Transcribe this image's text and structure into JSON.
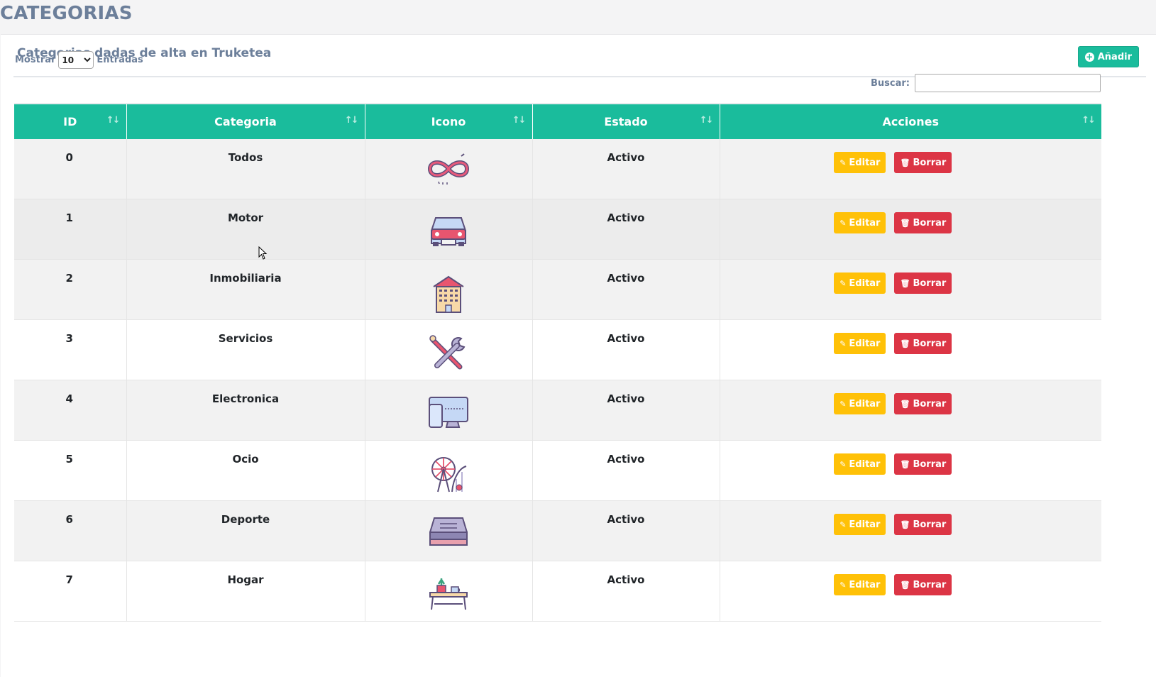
{
  "page": {
    "title": "CATEGORIAS"
  },
  "card": {
    "title": "Categorias dadas de alta en Truketea",
    "add_button": "Añadir"
  },
  "controls": {
    "show_label": "Mostrar",
    "entries_value": "10",
    "entries_label": "Entradas",
    "search_label": "Buscar:",
    "search_value": ""
  },
  "table": {
    "columns": [
      "ID",
      "Categoria",
      "Icono",
      "Estado",
      "Acciones"
    ],
    "edit_label": "Editar",
    "delete_label": "Borrar",
    "rows": [
      {
        "id": "0",
        "categoria": "Todos",
        "icono": "infinity-icon",
        "estado": "Activo"
      },
      {
        "id": "1",
        "categoria": "Motor",
        "icono": "car-icon",
        "estado": "Activo"
      },
      {
        "id": "2",
        "categoria": "Inmobiliaria",
        "icono": "building-icon",
        "estado": "Activo"
      },
      {
        "id": "3",
        "categoria": "Servicios",
        "icono": "tools-icon",
        "estado": "Activo"
      },
      {
        "id": "4",
        "categoria": "Electronica",
        "icono": "devices-icon",
        "estado": "Activo"
      },
      {
        "id": "5",
        "categoria": "Ocio",
        "icono": "ferris-wheel-icon",
        "estado": "Activo"
      },
      {
        "id": "6",
        "categoria": "Deporte",
        "icono": "tray-icon",
        "estado": "Activo"
      },
      {
        "id": "7",
        "categoria": "Hogar",
        "icono": "home-decor-icon",
        "estado": "Activo"
      }
    ]
  },
  "colors": {
    "header_bg": "#1abc9c",
    "edit_button": "#ffc107",
    "delete_button": "#dc3545",
    "title_text": "#6c7f9a"
  }
}
